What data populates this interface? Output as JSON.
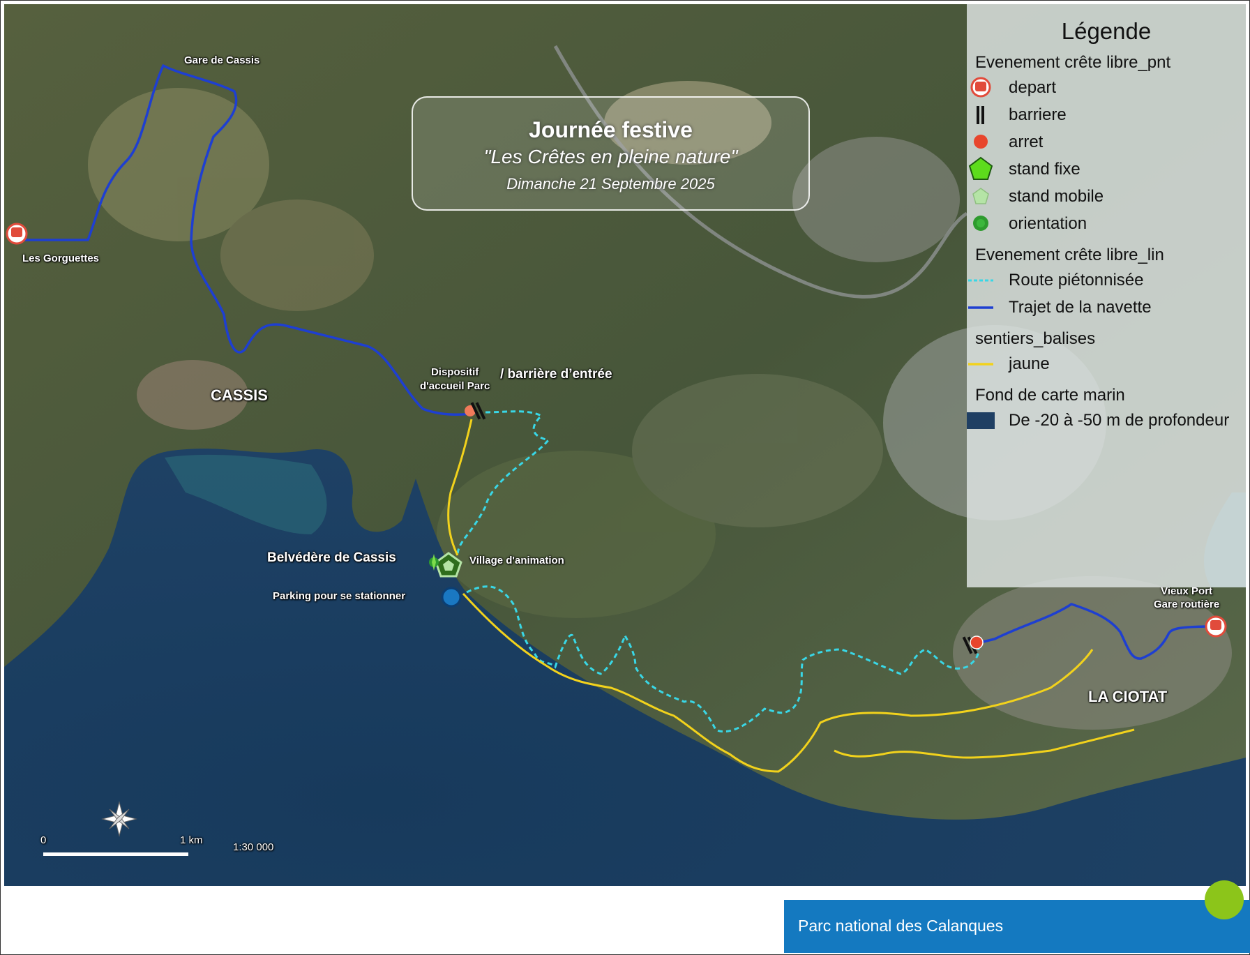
{
  "title": {
    "main": "Journée festive",
    "subtitle": "\"Les Crêtes en pleine nature\"",
    "date": "Dimanche 21 Septembre 2025"
  },
  "labels": {
    "gare_cassis": "Gare de Cassis",
    "gorguettes": "Les Gorguettes",
    "cassis": "CASSIS",
    "dispositif": "Dispositif\nd'accueil Parc",
    "barriere_entree": "/ barrière d’entrée",
    "belvedere": "Belvédère de Cassis",
    "village": "Village d'animation",
    "parking": "Parking pour se stationner",
    "vieux_port": "Vieux Port\nGare routière",
    "la_ciotat": "LA CIOTAT"
  },
  "legend": {
    "title": "Légende",
    "groups": [
      {
        "name": "Evenement crête libre_pnt",
        "items": [
          {
            "label": "depart",
            "icon": "bus-stop-icon",
            "color": "#e14b3b"
          },
          {
            "label": "barriere",
            "icon": "barrier-icon",
            "color": "#111111"
          },
          {
            "label": "arret",
            "icon": "stop-dot-icon",
            "color": "#e8452c"
          },
          {
            "label": "stand fixe",
            "icon": "pentagon-icon",
            "color": "#5ddc1c"
          },
          {
            "label": "stand mobile",
            "icon": "pentagon-light-icon",
            "color": "#b5e4a6"
          },
          {
            "label": "orientation",
            "icon": "compass-icon",
            "color": "#2e9b2e"
          }
        ]
      },
      {
        "name": "Evenement crête libre_lin",
        "items": [
          {
            "label": "Route piétonnisée",
            "icon": "dashed-line-icon",
            "color": "#39d7e6"
          },
          {
            "label": "Trajet de la navette",
            "icon": "solid-line-icon",
            "color": "#1e3fd1"
          }
        ]
      },
      {
        "name": "sentiers_balises",
        "items": [
          {
            "label": "jaune",
            "icon": "yellow-line-icon",
            "color": "#f2d21c"
          }
        ]
      },
      {
        "name": "Fond de carte marin",
        "items": [
          {
            "label": "De -20 à -50 m de profondeur",
            "icon": "depth-swatch-icon",
            "color": "#1f3f63"
          }
        ]
      }
    ]
  },
  "scale": {
    "zero": "0",
    "km": "1 km",
    "ratio": "1:30 000"
  },
  "footer": {
    "text": "Parc national des Calanques"
  },
  "colors": {
    "sea": "#1b3b5c",
    "land": "#3c4a2d",
    "shuttle": "#1e3fd1",
    "pedestrian": "#39d7e6",
    "trail": "#f2d21c",
    "footer": "#1479c0",
    "footer_dot": "#8cc51a"
  }
}
